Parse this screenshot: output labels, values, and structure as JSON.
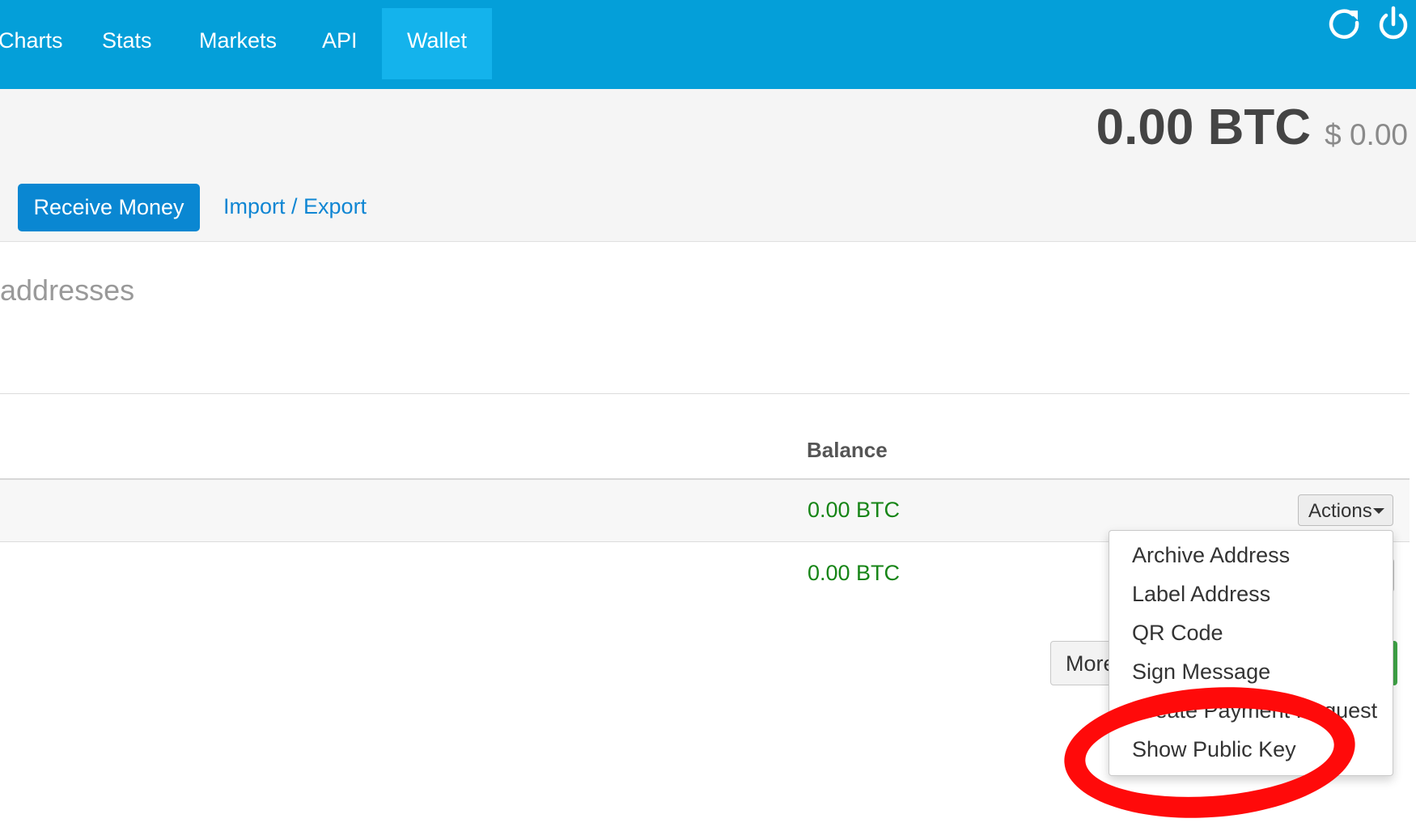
{
  "nav": {
    "items": [
      {
        "label": "Charts"
      },
      {
        "label": "Stats"
      },
      {
        "label": "Markets"
      },
      {
        "label": "API"
      },
      {
        "label": "Wallet"
      }
    ],
    "active": "Wallet",
    "icons": [
      "refresh-icon",
      "power-icon"
    ]
  },
  "balance": {
    "btc": "0.00 BTC",
    "usd": "$ 0.00"
  },
  "header": {
    "receive_button": "Receive Money",
    "import_export": "Import / Export"
  },
  "section": {
    "title": "addresses"
  },
  "table": {
    "balance_header": "Balance",
    "rows": [
      {
        "balance": "0.00 BTC"
      },
      {
        "balance": "0.00 BTC"
      }
    ],
    "actions_label": "Actions",
    "more_label": "More"
  },
  "dropdown": {
    "items": [
      "Archive Address",
      "Label Address",
      "QR Code",
      "Sign Message",
      "Create Payment Request",
      "Show Public Key"
    ]
  },
  "colors": {
    "nav_bg": "#049fd9",
    "nav_active": "#14b3ec",
    "primary_button": "#0a87d2",
    "balance_green": "#178517",
    "annotation_red": "#ff0a0a"
  }
}
